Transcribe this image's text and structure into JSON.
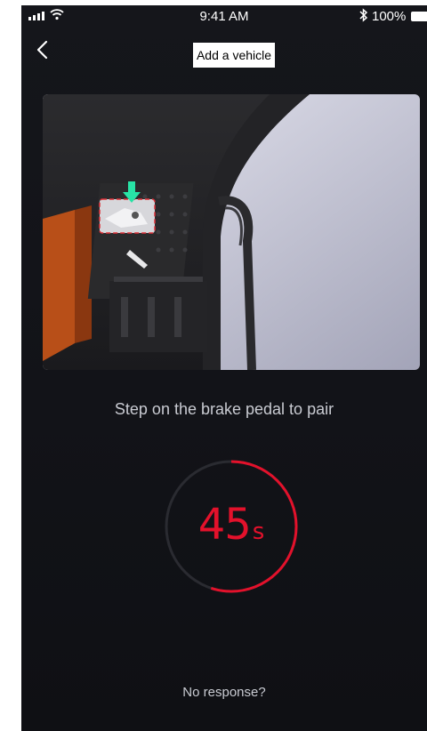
{
  "status_bar": {
    "time": "9:41 AM",
    "battery": "100%",
    "icons": [
      "signal-icon",
      "wifi-icon",
      "bluetooth-icon",
      "battery-icon"
    ]
  },
  "header": {
    "title": "Add a vehicle",
    "back_icon": "chevron-left-icon"
  },
  "instruction": "Step on the brake pedal to pair",
  "timer": {
    "value": "45",
    "unit": "s",
    "progress": 0.55,
    "color": "#e3112b"
  },
  "no_response_label": "No response?",
  "colors": {
    "background": "#131419",
    "accent": "#e3112b",
    "hint_arrow": "#28e3a6"
  }
}
